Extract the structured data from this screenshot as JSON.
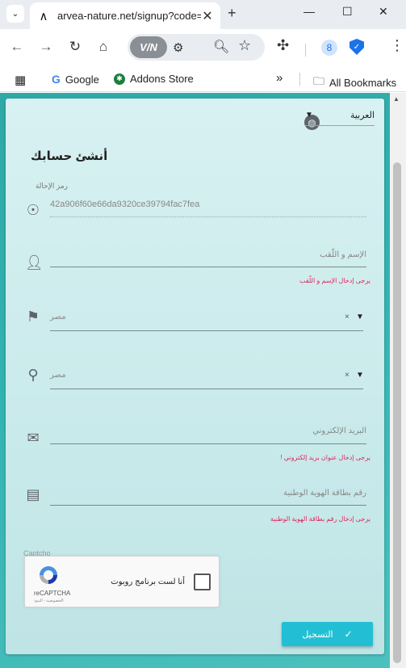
{
  "browser": {
    "tab_title": "arvea-nature.net/signup?code=",
    "tab_close": "✕",
    "new_tab": "+",
    "vpn_label": "V/N",
    "profile_initial": "8",
    "bookmarks": [
      {
        "label": "Google"
      },
      {
        "label": "Addons Store"
      }
    ],
    "bookmarks_more": "»",
    "all_bookmarks": "All Bookmarks"
  },
  "form": {
    "language": "العربية",
    "heading": "أنشئ حسابك",
    "referral": {
      "label": "رمز الإحالة",
      "value": "42a906f60e66da9320ce39794fac7fea"
    },
    "name": {
      "placeholder": "الإسم و اللّقب",
      "error": "يرجى إدخال الإسم و اللّقب"
    },
    "country": {
      "value": "مصر",
      "clear": "×",
      "arrow": "▼"
    },
    "city": {
      "value": "مصر",
      "clear": "×",
      "arrow": "▼"
    },
    "email": {
      "placeholder": "البريد الإلكتروني",
      "error": "يرجى إدخال عنوان بريد إلكتروني !"
    },
    "national_id": {
      "placeholder": "رقم بطاقة الهوية الوطنية",
      "error": "يرجى إدخال رقم بطاقة الهوية الوطنية"
    },
    "captcha": {
      "section_label": "Captcho",
      "checkbox_text": "أنا لست برنامج روبوت",
      "brand": "reCAPTCHA",
      "links": "الخصوصية - البنود"
    },
    "submit_label": "التسجيل"
  },
  "colors": {
    "page_bg": "#31b2b0",
    "accent": "#22bfd4",
    "error": "#e0245e"
  }
}
